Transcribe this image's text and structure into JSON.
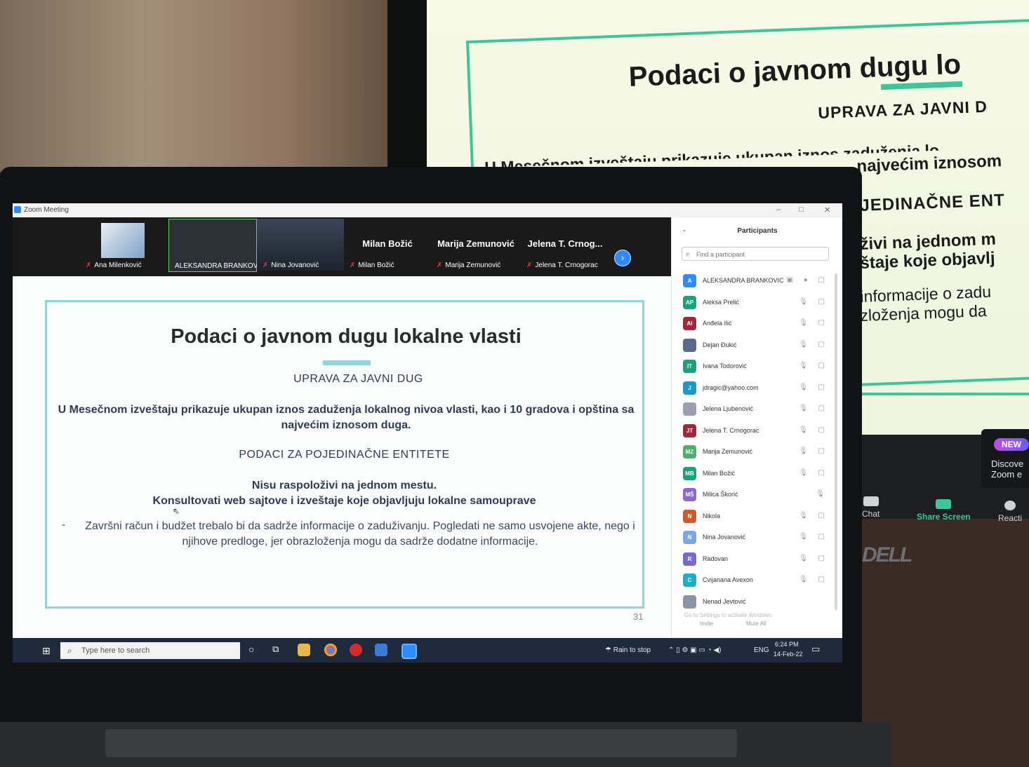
{
  "monitor": {
    "title": "Podaci o javnom dugu lo",
    "subtitle": "UPRAVA ZA JAVNI D",
    "line1": "U Mesečnom izveštaju prikazuje ukupan iznos zaduženja lo",
    "line2": "najvećim iznosom",
    "entities": "JEDINAČNE ENT",
    "nisu1": "živi na jednom m",
    "nisu2": "štaje koje objavlj",
    "z1": "informacije o zadu",
    "z2": "zloženja mogu da",
    "toolbar": {
      "chat": "Chat",
      "share": "Share Screen",
      "react": "Reacti",
      "new_badge": "NEW",
      "discover1": "Discove",
      "discover2": "Zoom e"
    },
    "brand": "DELL",
    "colors": {
      "accent": "#3cc79a"
    }
  },
  "zoom": {
    "window_title": "Zoom Meeting",
    "controls": {
      "minimize": "–",
      "maximize": "□",
      "close": "✕"
    },
    "strip": [
      {
        "name": "Ana Milenković",
        "type": "video"
      },
      {
        "name": "ALEKSANDRA BRANKOVIC",
        "type": "video"
      },
      {
        "name": "Nina Jovanović",
        "type": "video"
      },
      {
        "name": "Milan Božić",
        "big": "Milan Božić",
        "type": "name"
      },
      {
        "name": "Marija Zemunović",
        "big": "Marija Zemunović",
        "type": "name"
      },
      {
        "name": "Jelena T. Crnogorac",
        "big": "Jelena T. Crnog...",
        "type": "name"
      }
    ],
    "next_icon": "›"
  },
  "slide": {
    "title": "Podaci o javnom dugu lokalne vlasti",
    "subtitle": "UPRAVA ZA JAVNI DUG",
    "paragraph": "U Mesečnom izveštaju prikazuje ukupan iznos zaduženja lokalnog nivoa vlasti, kao i 10 gradova i opština sa najvećim iznosom duga.",
    "entities": "PODACI ZA POJEDINAČNE ENTITETE",
    "nisu1": "Nisu raspoloživi na jednom mestu.",
    "nisu2": "Konsultovati web sajtove i izveštaje koje objavljuju lokalne samouprave",
    "dash": "-",
    "zavrsni": "Završni račun i budžet trebalo bi da sadrže informacije o zaduživanju. Pogledati ne samo usvojene akte, nego i njihove predloge, jer obrazloženja mogu da sadrže dodatne informacije.",
    "page_number": "31",
    "colors": {
      "frame": "#8ed6d8"
    }
  },
  "participants": {
    "header": "Participants",
    "search_placeholder": "Find a participant",
    "list": [
      {
        "initials": "A",
        "name": "ALEKSANDRA BRANKOVIC",
        "color": "#2d8cff",
        "icons": "▣ ● ▢"
      },
      {
        "initials": "AP",
        "name": "Aleksa Prelić",
        "color": "#1aa37a",
        "icons": "🎙 ▢"
      },
      {
        "initials": "AI",
        "name": "Anđela Ilić",
        "color": "#a3263a",
        "icons": "🎙 ▢"
      },
      {
        "initials": "",
        "name": "Dejan Đukić",
        "color": "#5a6a8a",
        "icons": "🎙 ▢"
      },
      {
        "initials": "IT",
        "name": "Ivana Todorović",
        "color": "#1aa37a",
        "icons": "🎙 ▢"
      },
      {
        "initials": "J",
        "name": "jdragic@yahoo.com",
        "color": "#1a9ac9",
        "icons": "🎙 ▢"
      },
      {
        "initials": "",
        "name": "Jelena Ljubenović",
        "color": "#9aa0b0",
        "icons": "🎙 ▢"
      },
      {
        "initials": "JT",
        "name": "Jelena T. Crnogorac",
        "color": "#a3263a",
        "icons": "🎙 ▢"
      },
      {
        "initials": "MZ",
        "name": "Marija Zemunović",
        "color": "#4caf6a",
        "icons": "🎙 ▢"
      },
      {
        "initials": "MB",
        "name": "Milan Božić",
        "color": "#1aa37a",
        "icons": "🎙 ▢"
      },
      {
        "initials": "MŠ",
        "name": "Milica Škorić",
        "color": "#8a6ad0",
        "icons": "🎙"
      },
      {
        "initials": "N",
        "name": "Nikola",
        "color": "#d05a2a",
        "icons": "🎙 ▢"
      },
      {
        "initials": "N",
        "name": "Nina Jovanović",
        "color": "#7aa7e8",
        "icons": "🎙 ▢"
      },
      {
        "initials": "R",
        "name": "Radovan",
        "color": "#7a6ad0",
        "icons": "🎙 ▢"
      },
      {
        "initials": "C",
        "name": "Cvijanana Avexon",
        "color": "#1ab0c9",
        "icons": "🎙 ▢"
      },
      {
        "initials": "",
        "name": "Nenad Jevtović",
        "color": "#8a94a8",
        "icons": ""
      }
    ],
    "footer_invite": "Invite",
    "footer_mute": "Mute All",
    "watermark": "Go to Settings to activate Windows."
  },
  "taskbar": {
    "search_placeholder": "Type here to search",
    "weather": "Rain to stop",
    "lang": "ENG",
    "time": "6:24 PM",
    "date": "14-Feb-22"
  }
}
